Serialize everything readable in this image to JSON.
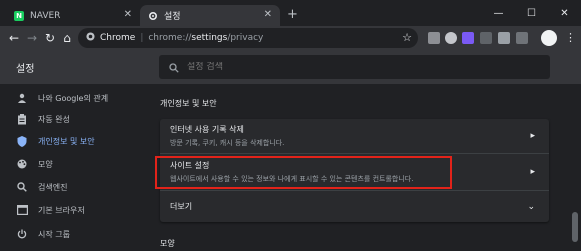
{
  "tabs": [
    {
      "title": "NAVER",
      "favicon": "N"
    },
    {
      "title": "설정",
      "favicon": "gear-icon"
    }
  ],
  "window_controls": {
    "minimize": "—",
    "maximize": "☐",
    "close": "✕"
  },
  "toolbar": {
    "site_name": "Chrome",
    "url_prefix": "chrome://",
    "url_path": "settings",
    "url_suffix": "/privacy"
  },
  "header": {
    "title": "설정",
    "search_placeholder": "설정 검색"
  },
  "sidebar": {
    "items": [
      {
        "label": "나와 Google의 관계",
        "icon": "person-icon"
      },
      {
        "label": "자동 완성",
        "icon": "clipboard-icon"
      },
      {
        "label": "개인정보 및 보안",
        "icon": "shield-icon",
        "active": true
      },
      {
        "label": "모양",
        "icon": "palette-icon"
      },
      {
        "label": "검색엔진",
        "icon": "search-icon"
      },
      {
        "label": "기본 브라우저",
        "icon": "browser-icon"
      },
      {
        "label": "시작 그룹",
        "icon": "power-icon"
      }
    ]
  },
  "main": {
    "section_title": "개인정보 및 보안",
    "rows": [
      {
        "title": "인터넷 사용 기록 삭제",
        "subtitle": "방문 기록, 쿠키, 캐시 등을 삭제합니다."
      },
      {
        "title": "사이트 설정",
        "subtitle": "웹사이트에서 사용할 수 있는 정보와 나에게 표시할 수 있는 콘텐츠를 컨트롤합니다."
      },
      {
        "title": "더보기"
      }
    ],
    "next_section_title": "모양"
  },
  "colors": {
    "accent": "#8ab4f8",
    "highlight_box": "#e2231a",
    "header_bg": "#35363a",
    "page_bg": "#202124",
    "card_bg": "#292a2d"
  }
}
